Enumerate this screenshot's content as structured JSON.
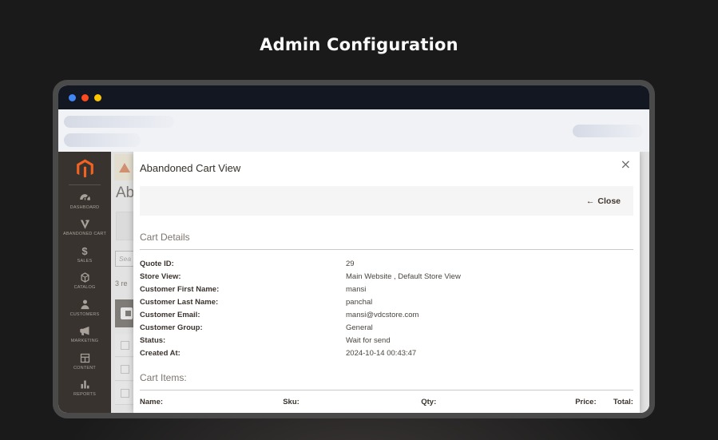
{
  "page": {
    "title": "Admin Configuration"
  },
  "window": {
    "traffic_lights": [
      "#4186f4",
      "#fb4b1e",
      "#fdc500"
    ]
  },
  "sidebar": {
    "items": [
      {
        "label": "DASHBOARD",
        "icon": "dashboard-icon"
      },
      {
        "label": "ABANDONED CART",
        "icon": "abandoned-cart-icon"
      },
      {
        "label": "SALES",
        "icon": "sales-icon",
        "glyph": "$"
      },
      {
        "label": "CATALOG",
        "icon": "catalog-icon"
      },
      {
        "label": "CUSTOMERS",
        "icon": "customers-icon"
      },
      {
        "label": "MARKETING",
        "icon": "marketing-icon"
      },
      {
        "label": "CONTENT",
        "icon": "content-icon"
      },
      {
        "label": "REPORTS",
        "icon": "reports-icon"
      }
    ]
  },
  "background_page": {
    "heading_fragment": "Ab",
    "search_placeholder_fragment": "Sea",
    "records_fragment": "3 re"
  },
  "modal": {
    "title": "Abandoned Cart View",
    "close_icon": "×",
    "toolbar": {
      "close_arrow": "←",
      "close_label": "Close"
    },
    "cart_details": {
      "heading": "Cart Details",
      "fields": [
        {
          "label": "Quote ID:",
          "value": "29"
        },
        {
          "label": "Store View:",
          "value": "Main Website , Default Store View"
        },
        {
          "label": "Customer First Name:",
          "value": "mansi"
        },
        {
          "label": "Customer Last Name:",
          "value": "panchal"
        },
        {
          "label": "Customer Email:",
          "value": "mansi@vdcstore.com"
        },
        {
          "label": "Customer Group:",
          "value": "General"
        },
        {
          "label": "Status:",
          "value": "Wait for send"
        },
        {
          "label": "Created At:",
          "value": "2024-10-14 00:43:47"
        }
      ]
    },
    "cart_items": {
      "heading": "Cart Items:",
      "columns": [
        "Name:",
        "Sku:",
        "Qty:",
        "Price:",
        "Total:"
      ]
    }
  },
  "colors": {
    "magento_orange": "#f26322",
    "titlebar": "#131722",
    "sidebar_bg": "#39332f",
    "backdrop": "rgba(200,200,200,0.45)"
  }
}
